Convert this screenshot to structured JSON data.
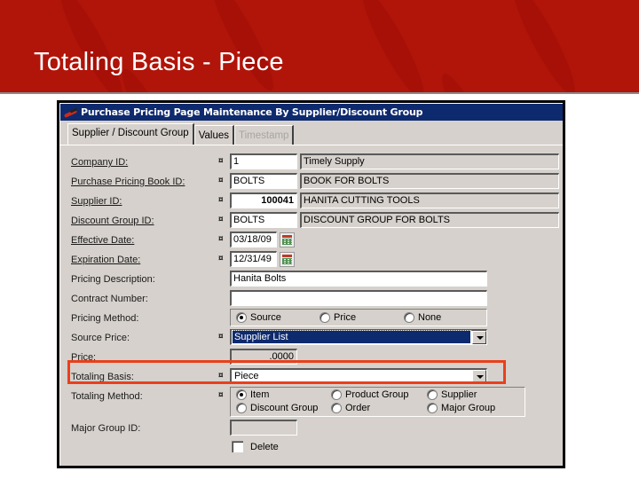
{
  "slide": {
    "title": "Totaling Basis - Piece"
  },
  "window": {
    "title": "Purchase Pricing Page Maintenance By Supplier/Discount Group",
    "tabs": [
      {
        "label": "Supplier / Discount Group",
        "state": "active"
      },
      {
        "label": "Values",
        "state": "normal"
      },
      {
        "label": "Timestamp",
        "state": "disabled"
      }
    ]
  },
  "required_marker": "¤",
  "form": {
    "company_id": {
      "label": "Company ID:",
      "value": "1",
      "description": "Timely Supply"
    },
    "book_id": {
      "label": "Purchase Pricing Book ID:",
      "value": "BOLTS",
      "description": "BOOK FOR BOLTS"
    },
    "supplier_id": {
      "label": "Supplier ID:",
      "value": "100041",
      "description": "HANITA CUTTING TOOLS"
    },
    "discount_group_id": {
      "label": "Discount Group ID:",
      "value": "BOLTS",
      "description": "DISCOUNT GROUP FOR BOLTS"
    },
    "effective_date": {
      "label": "Effective Date:",
      "value": "03/18/09"
    },
    "expiration_date": {
      "label": "Expiration Date:",
      "value": "12/31/49"
    },
    "pricing_description": {
      "label": "Pricing Description:",
      "value": "Hanita Bolts"
    },
    "contract_number": {
      "label": "Contract Number:",
      "value": ""
    },
    "pricing_method": {
      "label": "Pricing Method:",
      "options": [
        "Source",
        "Price",
        "None"
      ],
      "selected": "Source"
    },
    "source_price": {
      "label": "Source Price:",
      "value": "Supplier List"
    },
    "price": {
      "label": "Price:",
      "value": ".0000"
    },
    "totaling_basis": {
      "label": "Totaling Basis:",
      "value": "Piece"
    },
    "totaling_method": {
      "label": "Totaling Method:",
      "options": [
        "Item",
        "Product Group",
        "Supplier",
        "Discount Group",
        "Order",
        "Major Group"
      ],
      "selected": "Item"
    },
    "major_group_id": {
      "label": "Major Group ID:",
      "value": ""
    },
    "delete": {
      "label": "Delete",
      "checked": false
    }
  },
  "colors": {
    "banner": "#b11409",
    "titlebar": "#0e2a6e",
    "highlight": "#e8401c",
    "window_bg": "#d6d1cc"
  }
}
